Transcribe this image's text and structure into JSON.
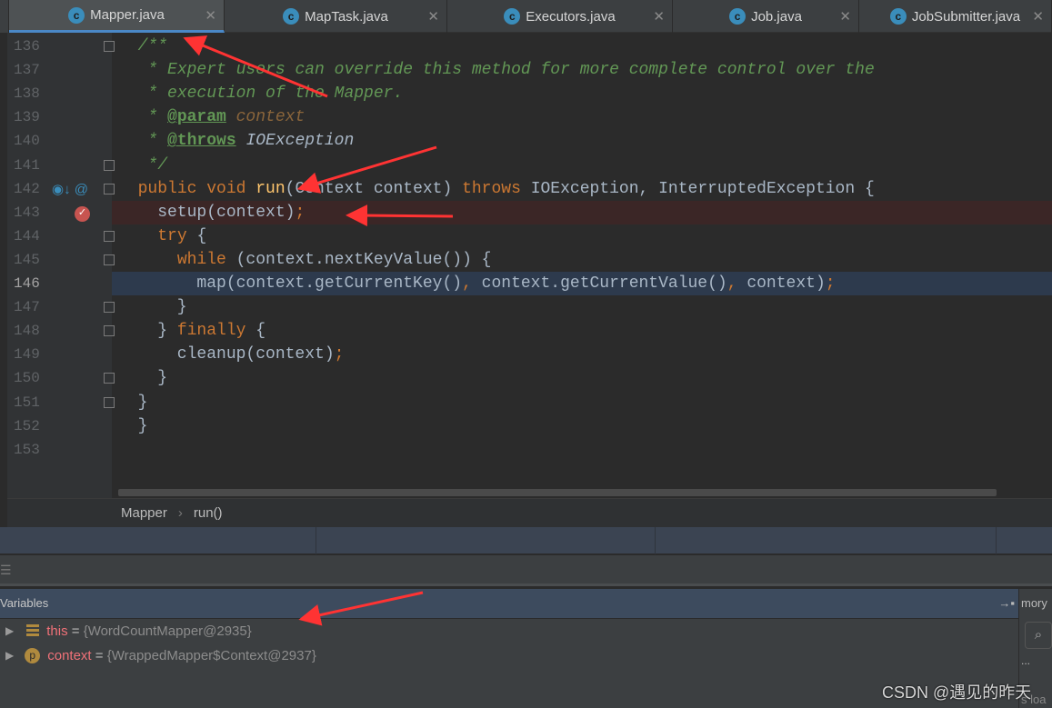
{
  "tabs": [
    {
      "label": "Mapper.java",
      "active": true
    },
    {
      "label": "MapTask.java"
    },
    {
      "label": "Executors.java"
    },
    {
      "label": "Job.java"
    },
    {
      "label": "JobSubmitter.java"
    }
  ],
  "editor": {
    "current_line": 146,
    "breakpoint_line": 143,
    "lines": [
      {
        "n": "136",
        "html": "<span class='c'>/**</span>"
      },
      {
        "n": "137",
        "html": "<span class='c'> * Expert users can override this method for more complete control over the</span>"
      },
      {
        "n": "138",
        "html": "<span class='c'> * execution of the Mapper.</span>"
      },
      {
        "n": "139",
        "html": "<span class='c'> * </span><span class='tag'>@param</span><span class='pr'> context</span>"
      },
      {
        "n": "140",
        "html": "<span class='c'> * </span><span class='tag'>@throws</span><span class='ex'> IOException</span>"
      },
      {
        "n": "141",
        "html": "<span class='c'> */</span>"
      },
      {
        "n": "142",
        "html": "<span class='k'>public void </span><span class='fn'>run</span>(Context context) <span class='k'>throws </span>IOException, InterruptedException {"
      },
      {
        "n": "143",
        "html": "  setup(context)<span class='k'>;</span>"
      },
      {
        "n": "144",
        "html": "  <span class='k'>try </span>{"
      },
      {
        "n": "145",
        "html": "    <span class='k'>while </span>(context.nextKeyValue()) {"
      },
      {
        "n": "146",
        "html": "      map(context.getCurrentKey()<span class='k'>, </span>context.getCurrentValue()<span class='k'>, </span>context)<span class='k'>;</span>"
      },
      {
        "n": "147",
        "html": "    }"
      },
      {
        "n": "148",
        "html": "  } <span class='k'>finally </span>{"
      },
      {
        "n": "149",
        "html": "    cleanup(context)<span class='k'>;</span>"
      },
      {
        "n": "150",
        "html": "  }"
      },
      {
        "n": "151",
        "html": "}"
      },
      {
        "n": "152",
        "html": "}"
      },
      {
        "n": "153",
        "html": ""
      }
    ]
  },
  "breadcrumb": {
    "class": "Mapper",
    "method": "run()"
  },
  "variables": {
    "title": "Variables",
    "side_label": "mory",
    "side_bottom": "s loa",
    "items": [
      {
        "icon": "field-icon",
        "name": "this",
        "value": "{WordCountMapper@2935}"
      },
      {
        "icon": "parameter-icon",
        "icon_letter": "p",
        "name": "context",
        "value": "{WrappedMapper$Context@2937}"
      }
    ]
  },
  "watermark": "CSDN @遇见的昨天",
  "colors": {
    "keyword": "#cc7832",
    "comment": "#629755",
    "annotation_arrow": "#ff3333",
    "tab_accent": "#4a88c7"
  }
}
